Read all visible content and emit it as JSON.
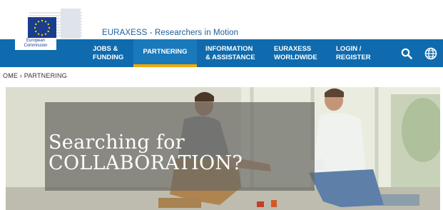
{
  "brand": {
    "logo_text": "European\nCommission",
    "site_title": "EURAXESS - Researchers in Motion"
  },
  "nav": {
    "items": [
      {
        "label": "JOBS &\nFUNDING"
      },
      {
        "label": "PARTNERING"
      },
      {
        "label": "INFORMATION\n& ASSISTANCE"
      },
      {
        "label": "EURAXESS\nWORLDWIDE"
      },
      {
        "label": "LOGIN /\nREGISTER"
      }
    ],
    "search_icon": "search-icon",
    "language_icon": "globe-icon"
  },
  "breadcrumb": "OME › PARTNERING",
  "hero": {
    "title": "Searching for\nCOLLABORATION?"
  },
  "colors": {
    "nav_bg": "#0f6bad",
    "active_underline": "#f2a900",
    "title_color": "#1a5c99"
  }
}
